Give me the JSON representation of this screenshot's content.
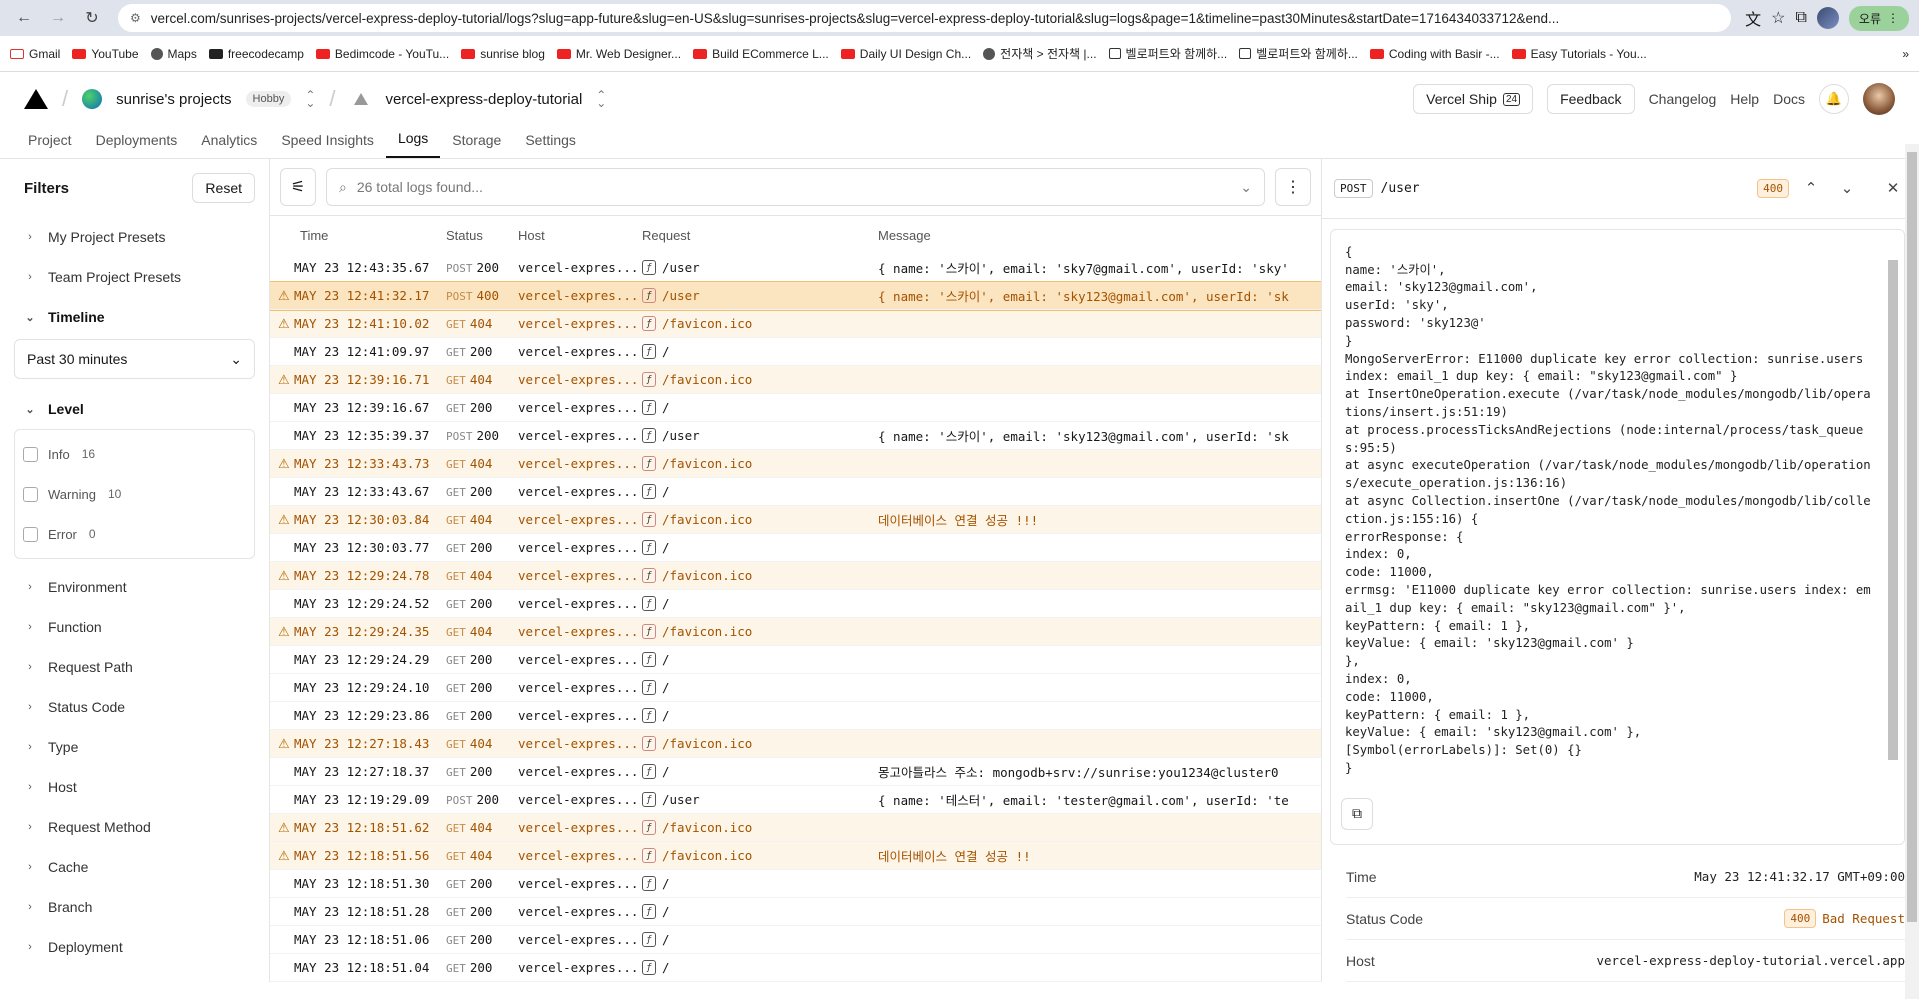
{
  "browser": {
    "url": "vercel.com/sunrises-projects/vercel-express-deploy-tutorial/logs?slug=app-future&slug=en-US&slug=sunrises-projects&slug=vercel-express-deploy-tutorial&slug=logs&page=1&timeline=past30Minutes&startDate=1716434033712&end...",
    "profile_label": "오류",
    "bookmarks": [
      "Gmail",
      "YouTube",
      "Maps",
      "freecodecamp",
      "Bedimcode - YouTu...",
      "sunrise blog",
      "Mr. Web Designer...",
      "Build ECommerce L...",
      "Daily UI Design Ch...",
      "전자책 > 전자책 |...",
      "벨로퍼트와 함께하...",
      "벨로퍼트와 함께하...",
      "Coding with Basir -...",
      "Easy Tutorials - You..."
    ]
  },
  "header": {
    "team": "sunrise's projects",
    "plan": "Hobby",
    "project": "vercel-express-deploy-tutorial",
    "ship": "Vercel Ship",
    "ship_badge": "24",
    "feedback": "Feedback",
    "changelog": "Changelog",
    "help": "Help",
    "docs": "Docs"
  },
  "tabs": [
    "Project",
    "Deployments",
    "Analytics",
    "Speed Insights",
    "Logs",
    "Storage",
    "Settings"
  ],
  "filters": {
    "title": "Filters",
    "reset": "Reset",
    "my_presets": "My Project Presets",
    "team_presets": "Team Project Presets",
    "timeline": "Timeline",
    "timeline_value": "Past 30 minutes",
    "level": "Level",
    "levels": [
      {
        "label": "Info",
        "count": "16"
      },
      {
        "label": "Warning",
        "count": "10"
      },
      {
        "label": "Error",
        "count": "0"
      }
    ],
    "sections": [
      "Environment",
      "Function",
      "Request Path",
      "Status Code",
      "Type",
      "Host",
      "Request Method",
      "Cache",
      "Branch",
      "Deployment"
    ]
  },
  "logs": {
    "search_placeholder": "26 total logs found...",
    "columns": {
      "time": "Time",
      "status": "Status",
      "host": "Host",
      "request": "Request",
      "message": "Message"
    },
    "rows": [
      {
        "time": "MAY 23 12:43:35.67",
        "method": "POST",
        "status": "200",
        "host": "vercel-expres...",
        "path": "/user",
        "msg": "{ name: '스카이', email: 'sky7@gmail.com', userId: 'sky'",
        "warn": false,
        "sel": false
      },
      {
        "time": "MAY 23 12:41:32.17",
        "method": "POST",
        "status": "400",
        "host": "vercel-expres...",
        "path": "/user",
        "msg": "{ name: '스카이', email: 'sky123@gmail.com', userId: 'sk",
        "warn": true,
        "sel": true
      },
      {
        "time": "MAY 23 12:41:10.02",
        "method": "GET",
        "status": "404",
        "host": "vercel-expres...",
        "path": "/favicon.ico",
        "msg": "",
        "warn": true,
        "sel": false
      },
      {
        "time": "MAY 23 12:41:09.97",
        "method": "GET",
        "status": "200",
        "host": "vercel-expres...",
        "path": "/",
        "msg": "",
        "warn": false,
        "sel": false
      },
      {
        "time": "MAY 23 12:39:16.71",
        "method": "GET",
        "status": "404",
        "host": "vercel-expres...",
        "path": "/favicon.ico",
        "msg": "",
        "warn": true,
        "sel": false
      },
      {
        "time": "MAY 23 12:39:16.67",
        "method": "GET",
        "status": "200",
        "host": "vercel-expres...",
        "path": "/",
        "msg": "",
        "warn": false,
        "sel": false
      },
      {
        "time": "MAY 23 12:35:39.37",
        "method": "POST",
        "status": "200",
        "host": "vercel-expres...",
        "path": "/user",
        "msg": "{ name: '스카이', email: 'sky123@gmail.com', userId: 'sk",
        "warn": false,
        "sel": false
      },
      {
        "time": "MAY 23 12:33:43.73",
        "method": "GET",
        "status": "404",
        "host": "vercel-expres...",
        "path": "/favicon.ico",
        "msg": "",
        "warn": true,
        "sel": false
      },
      {
        "time": "MAY 23 12:33:43.67",
        "method": "GET",
        "status": "200",
        "host": "vercel-expres...",
        "path": "/",
        "msg": "",
        "warn": false,
        "sel": false
      },
      {
        "time": "MAY 23 12:30:03.84",
        "method": "GET",
        "status": "404",
        "host": "vercel-expres...",
        "path": "/favicon.ico",
        "msg": "데이터베이스 연결 성공 !!!",
        "warn": true,
        "sel": false
      },
      {
        "time": "MAY 23 12:30:03.77",
        "method": "GET",
        "status": "200",
        "host": "vercel-expres...",
        "path": "/",
        "msg": "",
        "warn": false,
        "sel": false
      },
      {
        "time": "MAY 23 12:29:24.78",
        "method": "GET",
        "status": "404",
        "host": "vercel-expres...",
        "path": "/favicon.ico",
        "msg": "",
        "warn": true,
        "sel": false
      },
      {
        "time": "MAY 23 12:29:24.52",
        "method": "GET",
        "status": "200",
        "host": "vercel-expres...",
        "path": "/",
        "msg": "",
        "warn": false,
        "sel": false
      },
      {
        "time": "MAY 23 12:29:24.35",
        "method": "GET",
        "status": "404",
        "host": "vercel-expres...",
        "path": "/favicon.ico",
        "msg": "",
        "warn": true,
        "sel": false
      },
      {
        "time": "MAY 23 12:29:24.29",
        "method": "GET",
        "status": "200",
        "host": "vercel-expres...",
        "path": "/",
        "msg": "",
        "warn": false,
        "sel": false
      },
      {
        "time": "MAY 23 12:29:24.10",
        "method": "GET",
        "status": "200",
        "host": "vercel-expres...",
        "path": "/",
        "msg": "",
        "warn": false,
        "sel": false
      },
      {
        "time": "MAY 23 12:29:23.86",
        "method": "GET",
        "status": "200",
        "host": "vercel-expres...",
        "path": "/",
        "msg": "",
        "warn": false,
        "sel": false
      },
      {
        "time": "MAY 23 12:27:18.43",
        "method": "GET",
        "status": "404",
        "host": "vercel-expres...",
        "path": "/favicon.ico",
        "msg": "",
        "warn": true,
        "sel": false
      },
      {
        "time": "MAY 23 12:27:18.37",
        "method": "GET",
        "status": "200",
        "host": "vercel-expres...",
        "path": "/",
        "msg": "몽고아틀라스 주소: mongodb+srv://sunrise:you1234@cluster0",
        "warn": false,
        "sel": false
      },
      {
        "time": "MAY 23 12:19:29.09",
        "method": "POST",
        "status": "200",
        "host": "vercel-expres...",
        "path": "/user",
        "msg": "{ name: '테스터', email: 'tester@gmail.com', userId: 'te",
        "warn": false,
        "sel": false
      },
      {
        "time": "MAY 23 12:18:51.62",
        "method": "GET",
        "status": "404",
        "host": "vercel-expres...",
        "path": "/favicon.ico",
        "msg": "",
        "warn": true,
        "sel": false
      },
      {
        "time": "MAY 23 12:18:51.56",
        "method": "GET",
        "status": "404",
        "host": "vercel-expres...",
        "path": "/favicon.ico",
        "msg": "데이터베이스 연결 성공 !!",
        "warn": true,
        "sel": false
      },
      {
        "time": "MAY 23 12:18:51.30",
        "method": "GET",
        "status": "200",
        "host": "vercel-expres...",
        "path": "/",
        "msg": "",
        "warn": false,
        "sel": false
      },
      {
        "time": "MAY 23 12:18:51.28",
        "method": "GET",
        "status": "200",
        "host": "vercel-expres...",
        "path": "/",
        "msg": "",
        "warn": false,
        "sel": false
      },
      {
        "time": "MAY 23 12:18:51.06",
        "method": "GET",
        "status": "200",
        "host": "vercel-expres...",
        "path": "/",
        "msg": "",
        "warn": false,
        "sel": false
      },
      {
        "time": "MAY 23 12:18:51.04",
        "method": "GET",
        "status": "200",
        "host": "vercel-expres...",
        "path": "/",
        "msg": "",
        "warn": false,
        "sel": false
      }
    ]
  },
  "detail": {
    "method": "POST",
    "path": "/user",
    "status": "400",
    "message": "{\nname: '스카이',\nemail: 'sky123@gmail.com',\nuserId: 'sky',\npassword: 'sky123@'\n}\nMongoServerError: E11000 duplicate key error collection: sunrise.users index: email_1 dup key: { email: \"sky123@gmail.com\" }\nat InsertOneOperation.execute (/var/task/node_modules/mongodb/lib/operations/insert.js:51:19)\nat process.processTicksAndRejections (node:internal/process/task_queues:95:5)\nat async executeOperation (/var/task/node_modules/mongodb/lib/operations/execute_operation.js:136:16)\nat async Collection.insertOne (/var/task/node_modules/mongodb/lib/collection.js:155:16) {\nerrorResponse: {\nindex: 0,\ncode: 11000,\nerrmsg: 'E11000 duplicate key error collection: sunrise.users index: email_1 dup key: { email: \"sky123@gmail.com\" }',\nkeyPattern: { email: 1 },\nkeyValue: { email: 'sky123@gmail.com' }\n},\nindex: 0,\ncode: 11000,\nkeyPattern: { email: 1 },\nkeyValue: { email: 'sky123@gmail.com' },\n[Symbol(errorLabels)]: Set(0) {}\n}",
    "time_label": "Time",
    "time_value": "May 23 12:41:32.17 GMT+09:00",
    "status_label": "Status Code",
    "status_text": "Bad Request",
    "host_label": "Host",
    "host_value": "vercel-express-deploy-tutorial.vercel.app"
  }
}
